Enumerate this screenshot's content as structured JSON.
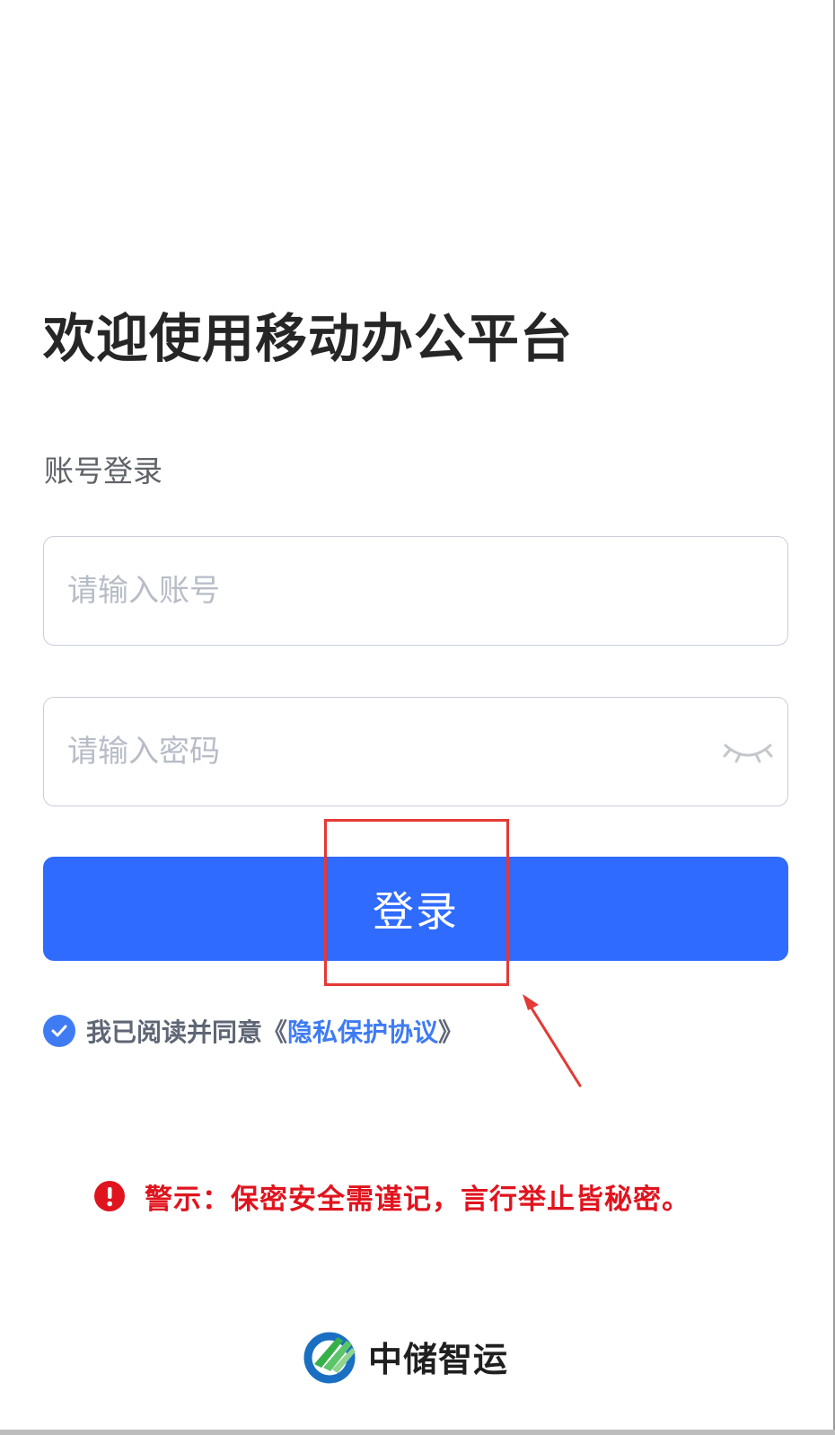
{
  "header": {
    "title": "欢迎使用移动办公平台",
    "subtitle": "账号登录"
  },
  "form": {
    "account_placeholder": "请输入账号",
    "account_value": "",
    "password_placeholder": "请输入密码",
    "password_value": "",
    "password_toggle_icon": "eye-closed-icon",
    "login_label": "登录"
  },
  "agreement": {
    "checked": true,
    "text": "我已阅读并同意《",
    "link": "隐私保护协议",
    "close": "》"
  },
  "warning": {
    "icon": "exclamation-icon",
    "text": "警示：保密安全需谨记，言行举止皆秘密。"
  },
  "brand": {
    "name": "中储智运"
  },
  "colors": {
    "primary": "#2f6bff",
    "link": "#3f7cf3",
    "warning": "#e0141e",
    "annotation": "#e53935"
  }
}
